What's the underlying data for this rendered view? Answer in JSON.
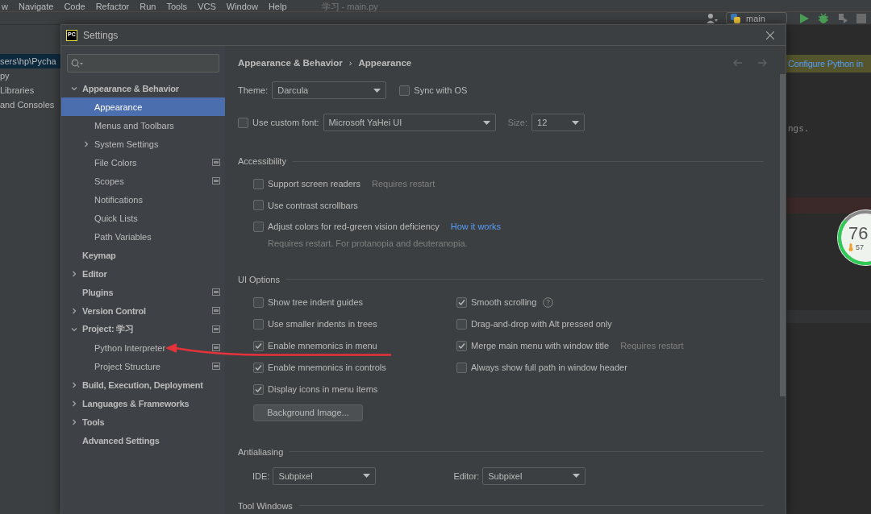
{
  "ide": {
    "menu": [
      "w",
      "Navigate",
      "Code",
      "Refactor",
      "Run",
      "Tools",
      "VCS",
      "Window",
      "Help"
    ],
    "title": "学习 - main.py",
    "run_config": "main",
    "project_tree": [
      {
        "label": "sers\\hp\\Pycha",
        "selected": true
      },
      {
        "label": "py",
        "selected": false
      },
      {
        "label": "Libraries",
        "selected": false
      },
      {
        "label": "and Consoles",
        "selected": false
      }
    ],
    "banner": "Configure Python in",
    "code_line": "ngs.",
    "monitor": {
      "value": "76",
      "temperature": "57"
    }
  },
  "dialog": {
    "logo": "PC",
    "title": "Settings",
    "tree": [
      {
        "label": "Appearance & Behavior",
        "expanded": true,
        "selected": false,
        "project_level": false,
        "children": [
          {
            "label": "Appearance",
            "selected": true,
            "project_level": false
          },
          {
            "label": "Menus and Toolbars",
            "selected": false,
            "project_level": false
          },
          {
            "label": "System Settings",
            "expanded": false,
            "selected": false,
            "project_level": false
          },
          {
            "label": "File Colors",
            "selected": false,
            "project_level": true
          },
          {
            "label": "Scopes",
            "selected": false,
            "project_level": true
          },
          {
            "label": "Notifications",
            "selected": false,
            "project_level": false
          },
          {
            "label": "Quick Lists",
            "selected": false,
            "project_level": false
          },
          {
            "label": "Path Variables",
            "selected": false,
            "project_level": false
          }
        ]
      },
      {
        "label": "Keymap",
        "selected": false,
        "project_level": false
      },
      {
        "label": "Editor",
        "expanded": false,
        "selected": false,
        "project_level": false
      },
      {
        "label": "Plugins",
        "selected": false,
        "project_level": true
      },
      {
        "label": "Version Control",
        "expanded": false,
        "selected": false,
        "project_level": true
      },
      {
        "label": "Project: 学习",
        "expanded": true,
        "selected": false,
        "project_level": true,
        "children": [
          {
            "label": "Python Interpreter",
            "selected": false,
            "project_level": true
          },
          {
            "label": "Project Structure",
            "selected": false,
            "project_level": true
          }
        ]
      },
      {
        "label": "Build, Execution, Deployment",
        "expanded": false,
        "selected": false,
        "project_level": false
      },
      {
        "label": "Languages & Frameworks",
        "expanded": false,
        "selected": false,
        "project_level": false
      },
      {
        "label": "Tools",
        "expanded": false,
        "selected": false,
        "project_level": false
      },
      {
        "label": "Advanced Settings",
        "selected": false,
        "project_level": false
      }
    ],
    "breadcrumb": [
      "Appearance & Behavior",
      "Appearance"
    ],
    "breadcrumb_separator": "›",
    "theme": {
      "label": "Theme:",
      "value": "Darcula"
    },
    "sync_with_os": {
      "label": "Sync with OS",
      "checked": false
    },
    "custom_font": {
      "label": "Use custom font:",
      "checked": false,
      "font": "Microsoft YaHei UI",
      "size_label": "Size:",
      "size": "12"
    },
    "accessibility": {
      "title": "Accessibility",
      "options": [
        {
          "label": "Support screen readers",
          "checked": false,
          "note": "Requires restart"
        },
        {
          "label": "Use contrast scrollbars",
          "checked": false
        },
        {
          "label": "Adjust colors for red-green vision deficiency",
          "checked": false,
          "link": "How it works",
          "hint": "Requires restart. For protanopia and deuteranopia."
        }
      ]
    },
    "ui_options": {
      "title": "UI Options",
      "left": [
        {
          "label": "Show tree indent guides",
          "checked": false
        },
        {
          "label": "Use smaller indents in trees",
          "checked": false
        },
        {
          "label": "Enable mnemonics in menu",
          "checked": true
        },
        {
          "label": "Enable mnemonics in controls",
          "checked": true
        },
        {
          "label": "Display icons in menu items",
          "checked": true
        }
      ],
      "right": [
        {
          "label": "Smooth scrolling",
          "checked": true,
          "help": true
        },
        {
          "label": "Drag-and-drop with Alt pressed only",
          "checked": false,
          "help": false
        },
        {
          "label": "Merge main menu with window title",
          "checked": true,
          "help": false,
          "note": "Requires restart"
        },
        {
          "label": "Always show full path in window header",
          "checked": false,
          "help": false
        }
      ],
      "button": "Background Image..."
    },
    "antialiasing": {
      "title": "Antialiasing",
      "ide_label": "IDE:",
      "ide_value": "Subpixel",
      "editor_label": "Editor:",
      "editor_value": "Subpixel"
    },
    "tool_windows": {
      "title": "Tool Windows"
    }
  }
}
